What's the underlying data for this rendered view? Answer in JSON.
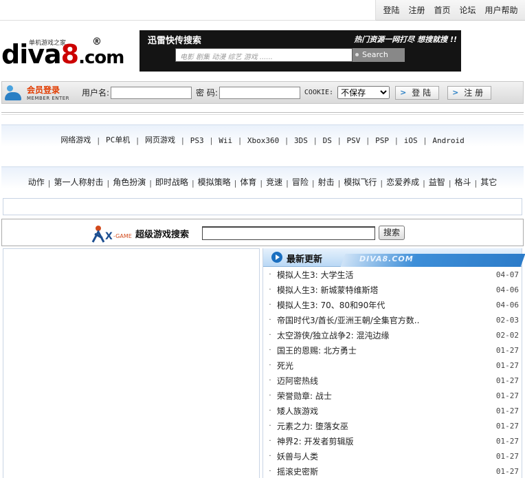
{
  "topnav": {
    "items": [
      "登陆",
      "注册",
      "首页",
      "论坛",
      "用户帮助"
    ]
  },
  "logo": {
    "tagline": "单机游戏之家",
    "text_diva": "diva",
    "text_8": "8",
    "text_com": ".com",
    "reg": "®"
  },
  "search_banner": {
    "title": "迅雷快传搜索",
    "slogan": "热门资源一网打尽  想搜就搜 !!",
    "placeholder": "电影 剧集 动漫 综艺 游戏 ......",
    "button": "Search"
  },
  "login": {
    "title": "会员登录",
    "subtitle": "MEMBER ENTER",
    "username_label": "用户名:",
    "password_label": "密 码:",
    "cookie_label": "COOKIE:",
    "cookie_value": "不保存",
    "login_button": "登 陆",
    "register_button": "注 册"
  },
  "platforms": [
    "网络游戏",
    "PC单机",
    "网页游戏",
    "PS3",
    "Wii",
    "Xbox360",
    "3DS",
    "DS",
    "PSV",
    "PSP",
    "iOS",
    "Android"
  ],
  "genres": [
    "动作",
    "第一人称射击",
    "角色扮演",
    "即时战略",
    "模拟策略",
    "体育",
    "竞速",
    "冒险",
    "射击",
    "模拟飞行",
    "恋爱养成",
    "益智",
    "格斗",
    "其它"
  ],
  "game_search": {
    "title": "超级游戏搜索",
    "button": "搜索"
  },
  "updates": {
    "title": "最新更新",
    "brand": "DIVA8.COM",
    "items": [
      {
        "name": "模拟人生3: 大学生活",
        "date": "04-07"
      },
      {
        "name": "模拟人生3: 新城蒙特维斯塔",
        "date": "04-06"
      },
      {
        "name": "模拟人生3: 70、80和90年代",
        "date": "04-06"
      },
      {
        "name": "帝国时代3/酋长/亚洲王朝/全集官方数..",
        "date": "02-03"
      },
      {
        "name": "太空游侠/独立战争2: 混沌边缘",
        "date": "02-02"
      },
      {
        "name": "国王的恩赐: 北方勇士",
        "date": "01-27"
      },
      {
        "name": "死光",
        "date": "01-27"
      },
      {
        "name": "迈阿密热线",
        "date": "01-27"
      },
      {
        "name": "荣誉勋章: 战士",
        "date": "01-27"
      },
      {
        "name": "矮人族游戏",
        "date": "01-27"
      },
      {
        "name": "元素之力: 堕落女巫",
        "date": "01-27"
      },
      {
        "name": "神界2: 开发者剪辑版",
        "date": "01-27"
      },
      {
        "name": "妖兽与人类",
        "date": "01-27"
      },
      {
        "name": "摇滚史密斯",
        "date": "01-27"
      }
    ]
  }
}
